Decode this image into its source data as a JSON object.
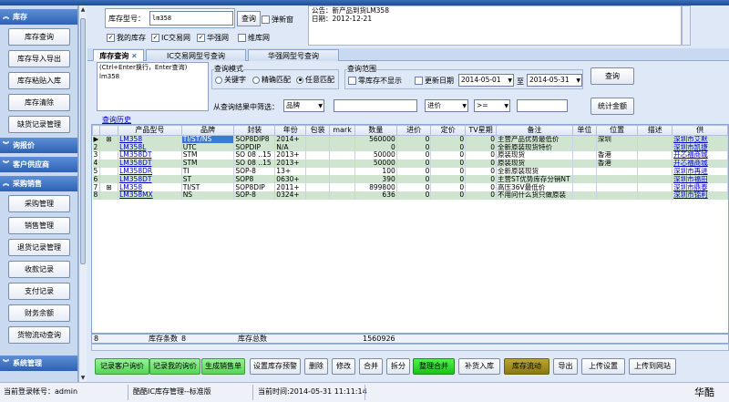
{
  "sidebar": {
    "sections": [
      {
        "label": "库存",
        "items": [
          "库存查询",
          "库存导入导出",
          "库存粘贴入库",
          "库存清除",
          "缺货记录管理"
        ]
      },
      {
        "label": "询报价",
        "items": []
      },
      {
        "label": "客户供应商",
        "items": []
      },
      {
        "label": "采购销售",
        "items": [
          "采购管理",
          "销售管理",
          "退货记录管理",
          "收款记录",
          "支付记录",
          "财务余额",
          "货物流动查询"
        ]
      },
      {
        "label": "系统管理",
        "items": []
      }
    ]
  },
  "header": {
    "model_label": "库存型号：",
    "model_value": "lm358",
    "query_label": "查询",
    "popup_label": "弹新窗",
    "checkboxes": [
      {
        "label": "我的库存",
        "checked": true
      },
      {
        "label": "IC交易网",
        "checked": true
      },
      {
        "label": "华强网",
        "checked": true
      },
      {
        "label": "维库网",
        "checked": false
      }
    ],
    "announcement": [
      "公告：新产品到货LM358",
      "日期：2012-12-21"
    ]
  },
  "tabs": [
    {
      "label": "库存查询",
      "active": true,
      "closable": true
    },
    {
      "label": "IC交易网型号查询",
      "active": false
    },
    {
      "label": "华强网型号查询",
      "active": false
    }
  ],
  "query": {
    "hint": "(Ctrl+Enter换行，Enter查询)",
    "hint_value": "lm358",
    "mode_title": "查询模式",
    "modes": [
      {
        "label": "关键字",
        "selected": false
      },
      {
        "label": "精确匹配",
        "selected": false
      },
      {
        "label": "任意匹配",
        "selected": true
      }
    ],
    "range_title": "查询范围",
    "zero_stock_label": "零库存不显示",
    "update_date_label": "更新日期",
    "date_from": "2014-05-01",
    "date_to_label": "至",
    "date_to": "2014-05-31",
    "query_label": "查询",
    "filter_label": "从查询结果中筛选：",
    "filter_field": "品牌",
    "price_field": "进价",
    "price_op": ">=",
    "stat_label": "统计金额",
    "history_label": "查询历史"
  },
  "grid": {
    "columns": [
      "",
      "",
      "产品型号",
      "品牌",
      "封装",
      "年份",
      "包装",
      "mark",
      "数量",
      "进价",
      "定价",
      "TV星期",
      "备注",
      "单位",
      "位置",
      "描述",
      "供"
    ],
    "rows": [
      {
        "idx": "1",
        "model": "LM358",
        "brand": "TI/ST/NS",
        "pkg": "SOP8DIP8",
        "year": "2014+",
        "packing": "",
        "mark": "",
        "qty": "560000",
        "cost": "0",
        "price": "0",
        "tv": "0",
        "note": "主营产品优势最低价",
        "unit": "",
        "loc": "深圳",
        "desc": "",
        "supplier": "深圳市艾默",
        "selected": true
      },
      {
        "idx": "2",
        "model": "LM358L",
        "brand": "UTC",
        "pkg": "SOPDIP",
        "year": "N/A",
        "packing": "",
        "mark": "",
        "qty": "0",
        "cost": "0",
        "price": "0",
        "tv": "0",
        "note": "全新原装现货特价",
        "unit": "",
        "loc": "",
        "desc": "",
        "supplier": "深圳市凯捷"
      },
      {
        "idx": "3",
        "model": "LM358DT",
        "brand": "STM",
        "pkg": "SO 08 ..15",
        "year": "2013+",
        "packing": "",
        "mark": "",
        "qty": "50000",
        "cost": "0",
        "price": "0",
        "tv": "0",
        "note": "原装现货",
        "unit": "",
        "loc": "香港",
        "desc": "",
        "supplier": "开芯福商城"
      },
      {
        "idx": "4",
        "model": "LM358DT",
        "brand": "STM",
        "pkg": "SO 08 ..15",
        "year": "2013+",
        "packing": "",
        "mark": "",
        "qty": "50000",
        "cost": "0",
        "price": "0",
        "tv": "0",
        "note": "原装现货",
        "unit": "",
        "loc": "香港",
        "desc": "",
        "supplier": "开芯福商城"
      },
      {
        "idx": "5",
        "model": "LM358DR",
        "brand": "TI",
        "pkg": "SOP-8",
        "year": "13+",
        "packing": "",
        "mark": "",
        "qty": "100",
        "cost": "0",
        "price": "0",
        "tv": "0",
        "note": "全新原装现货",
        "unit": "",
        "loc": "",
        "desc": "",
        "supplier": "深圳市再进"
      },
      {
        "idx": "6",
        "model": "LM358DT",
        "brand": "ST",
        "pkg": "SOP8",
        "year": "0630+",
        "packing": "",
        "mark": "",
        "qty": "390",
        "cost": "0",
        "price": "0",
        "tv": "0",
        "note": "主营ST优势库存分销NT",
        "unit": "",
        "loc": "",
        "desc": "",
        "supplier": "深圳市福田"
      },
      {
        "idx": "7",
        "model": "LM358",
        "brand": "TI/ST",
        "pkg": "SOP8DIP",
        "year": "2011+",
        "packing": "",
        "mark": "",
        "qty": "899800",
        "cost": "0",
        "price": "0",
        "tv": "0",
        "note": "高压36V最低价",
        "unit": "",
        "loc": "",
        "desc": "",
        "supplier": "深圳市鼎泰"
      },
      {
        "idx": "8",
        "model": "LM358MX",
        "brand": "NS",
        "pkg": "SOP-8",
        "year": "0324+",
        "packing": "",
        "mark": "",
        "qty": "636",
        "cost": "0",
        "price": "0",
        "tv": "0",
        "note": "不用问什么货只做原装",
        "unit": "",
        "loc": "",
        "desc": "",
        "supplier": "深圳市锦利"
      }
    ],
    "footer": {
      "count_idx": "8",
      "count_label": "库存条数",
      "count": "8",
      "total_label": "库存总数",
      "total": "1560926"
    }
  },
  "actions": [
    {
      "label": "记录客户询价",
      "style": "green"
    },
    {
      "label": "记录我的询价",
      "style": "green"
    },
    {
      "label": "生成销售单",
      "style": "green"
    },
    {
      "label": "设置库存预警",
      "style": "normal"
    },
    {
      "label": "删除",
      "style": "normal"
    },
    {
      "label": "修改",
      "style": "normal"
    },
    {
      "label": "合并",
      "style": "normal"
    },
    {
      "label": "拆分",
      "style": "normal"
    },
    {
      "label": "整理合并",
      "style": "lime"
    },
    {
      "label": "补货入库",
      "style": "normal"
    },
    {
      "label": "库存流动",
      "style": "olive"
    },
    {
      "label": "导出",
      "style": "normal"
    },
    {
      "label": "上传设置",
      "style": "normal"
    },
    {
      "label": "上传到网站",
      "style": "normal"
    }
  ],
  "status": {
    "user": "当前登录帐号：admin",
    "app": "酷酷IC库存管理--标准版",
    "time": "当前时间:2014-05-31 11:11:14",
    "brand": "华酷"
  }
}
